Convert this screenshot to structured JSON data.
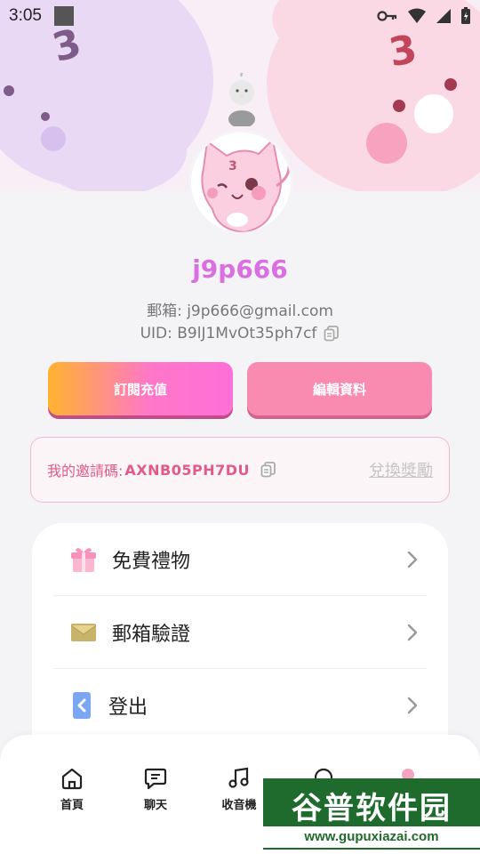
{
  "status_bar": {
    "time": "3:05"
  },
  "profile": {
    "username": "j9p666",
    "email_line": "郵箱: j9p666@gmail.com",
    "uid_line": "UID: B9lJ1MvOt35ph7cf"
  },
  "actions": {
    "subscribe_label": "訂閱充值",
    "edit_label": "編輯資料"
  },
  "invite": {
    "label": "我的邀請碼:",
    "code": "AXNB05PH7DU",
    "redeem_label": "兌換獎勵"
  },
  "menu": [
    {
      "label": "免費禮物",
      "icon": "gift-icon"
    },
    {
      "label": "郵箱驗證",
      "icon": "envelope-icon"
    },
    {
      "label": "登出",
      "icon": "logout-icon"
    }
  ],
  "bottom_nav": [
    {
      "label": "首頁",
      "icon": "home-icon"
    },
    {
      "label": "聊天",
      "icon": "chat-icon"
    },
    {
      "label": "收音機",
      "icon": "music-icon"
    },
    {
      "label": "",
      "icon": "search-icon"
    },
    {
      "label": "",
      "icon": "profile-icon"
    }
  ],
  "watermark": {
    "title": "谷普软件园",
    "url": "www.gupuxiazai.com"
  },
  "colors": {
    "accent": "#d96fe0",
    "pink": "#f98bb1",
    "invite_text": "#e25a8c"
  }
}
